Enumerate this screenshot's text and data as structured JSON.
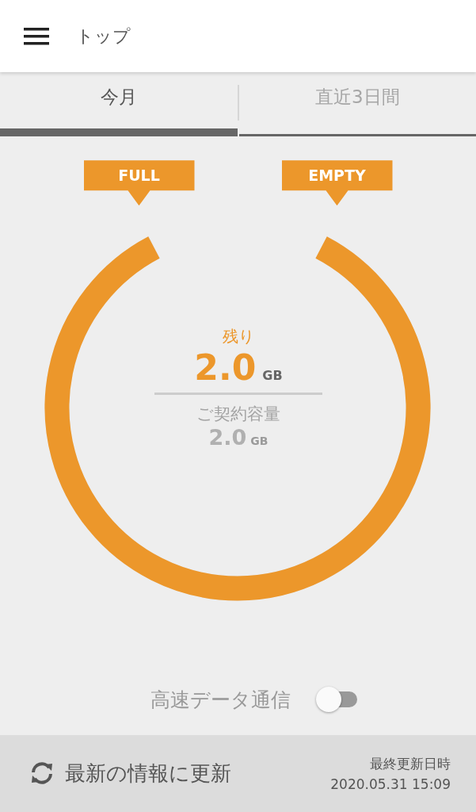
{
  "header": {
    "title": "トップ"
  },
  "tabs": [
    {
      "label": "今月",
      "selected": true
    },
    {
      "label": "直近3日間",
      "selected": false
    }
  ],
  "gauge": {
    "full_label": "FULL",
    "empty_label": "EMPTY",
    "remaining_label": "残り",
    "remaining_value": "2.0",
    "remaining_unit": "GB",
    "contract_label": "ご契約容量",
    "contract_value": "2.0",
    "contract_unit": "GB"
  },
  "high_speed": {
    "label": "高速データ通信",
    "on": false
  },
  "footer": {
    "refresh_label": "最新の情報に更新",
    "updated_label": "最終更新日時",
    "updated_time": "2020.05.31 15:09"
  }
}
